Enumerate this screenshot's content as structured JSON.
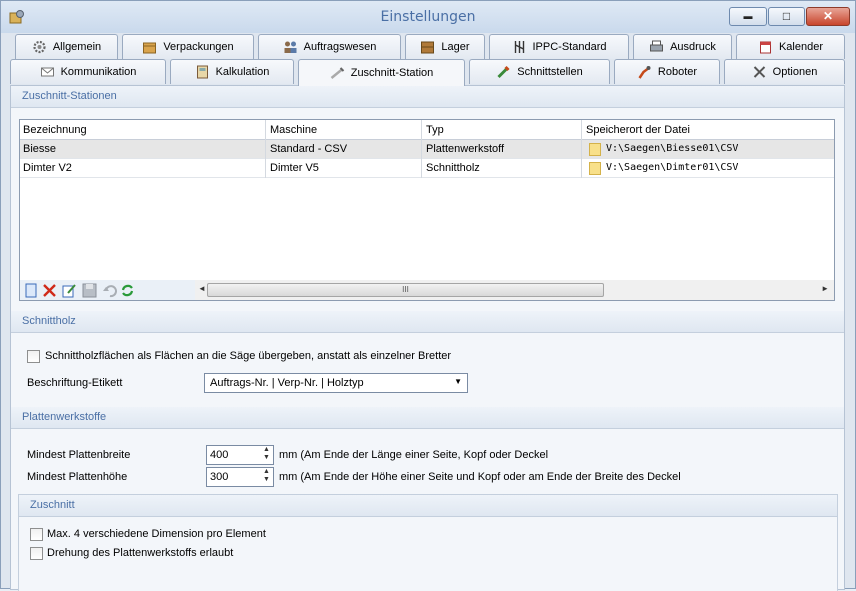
{
  "window": {
    "title": "Einstellungen",
    "min_glyph": "▬",
    "max_glyph": "□",
    "close_glyph": "✕"
  },
  "tabs_row1": [
    {
      "label": "Allgemein",
      "icon": "gear-icon"
    },
    {
      "label": "Verpackungen",
      "icon": "box-icon"
    },
    {
      "label": "Auftragswesen",
      "icon": "people-icon"
    },
    {
      "label": "Lager",
      "icon": "crate-icon"
    },
    {
      "label": "IPPC-Standard",
      "icon": "ippc-icon"
    },
    {
      "label": "Ausdruck",
      "icon": "printer-icon"
    },
    {
      "label": "Kalender",
      "icon": "calendar-icon"
    }
  ],
  "tabs_row2": [
    {
      "label": "Kommunikation",
      "icon": "mail-icon"
    },
    {
      "label": "Kalkulation",
      "icon": "calculator-icon"
    },
    {
      "label": "Zuschnitt-Station",
      "icon": "saw-icon",
      "active": true
    },
    {
      "label": "Schnittstellen",
      "icon": "plug-icon"
    },
    {
      "label": "Roboter",
      "icon": "robot-icon"
    },
    {
      "label": "Optionen",
      "icon": "tools-icon"
    }
  ],
  "stations": {
    "section_title": "Zuschnitt-Stationen",
    "columns": [
      "Bezeichnung",
      "Maschine",
      "Typ",
      "Speicherort der Datei"
    ],
    "rows": [
      {
        "name": "Biesse",
        "machine": "Standard - CSV",
        "type": "Plattenwerkstoff",
        "path": "V:\\Saegen\\Biesse01\\CSV"
      },
      {
        "name": "Dimter V2",
        "machine": "Dimter V5",
        "type": "Schnittholz",
        "path": "V:\\Saegen\\Dimter01\\CSV"
      }
    ],
    "toolbar_icons": [
      "new-icon",
      "delete-icon",
      "edit-icon",
      "save-icon",
      "undo-icon",
      "refresh-icon"
    ],
    "scroll_left": "◄",
    "scroll_right": "►",
    "scroll_grip": "III"
  },
  "schnittholz": {
    "section_title": "Schnittholz",
    "checkbox_label": "Schnittholzflächen als Flächen an die Säge übergeben, anstatt als einzelner Bretter",
    "checkbox_checked": false,
    "label_field": "Beschriftung-Etikett",
    "label_value": "Auftrags-Nr. | Verp-Nr. | Holztyp"
  },
  "platten": {
    "section_title": "Plattenwerkstoffe",
    "min_width_label": "Mindest Plattenbreite",
    "min_width_value": "400",
    "min_width_hint": "mm (Am Ende der Länge einer Seite, Kopf oder Deckel",
    "min_height_label": "Mindest Plattenhöhe",
    "min_height_value": "300",
    "min_height_hint": "mm (Am Ende der Höhe einer Seite und Kopf oder am Ende der Breite des Deckel"
  },
  "zuschnitt": {
    "section_title": "Zuschnitt",
    "option1": "Max. 4 verschiedene Dimension pro Element",
    "option2": "Drehung des Plattenwerkstoffs erlaubt"
  },
  "glyphs": {
    "spin_up": "▲",
    "spin_down": "▼",
    "dropdown": "▼"
  }
}
